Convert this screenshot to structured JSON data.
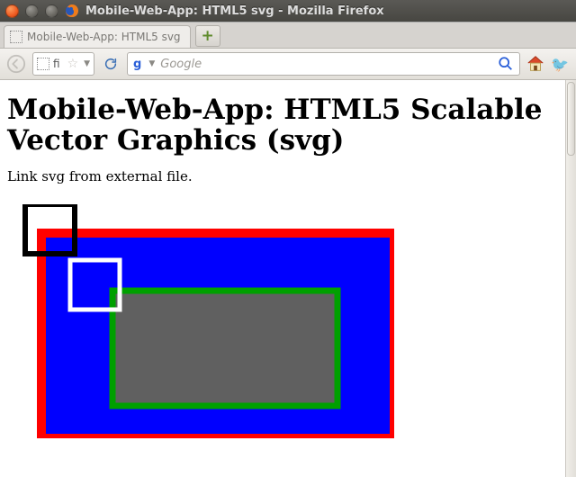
{
  "window": {
    "title": "Mobile-Web-App: HTML5 svg - Mozilla Firefox"
  },
  "tabs": {
    "active_label": "Mobile-Web-App: HTML5 svg"
  },
  "nav": {
    "address_text": "fi",
    "search_placeholder": "Google"
  },
  "page": {
    "heading": "Mobile-Web-App: HTML5 Scalable Vector Graphics (svg)",
    "paragraph": "Link svg from external file."
  },
  "colors": {
    "rect_outer_stroke": "#ff0000",
    "rect_outer_fill": "#0000ff",
    "rect_inner_stroke": "#00a000",
    "rect_inner_fill": "#606060",
    "sq_black": "#000000",
    "sq_white": "#ffffff"
  }
}
